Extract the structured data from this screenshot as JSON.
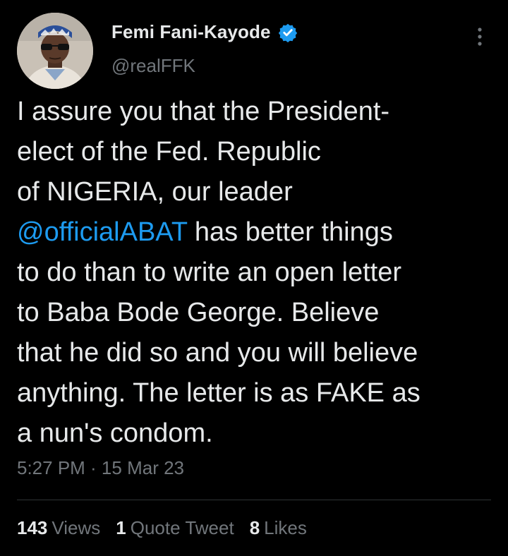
{
  "author": {
    "display_name": "Femi Fani-Kayode",
    "handle": "@realFFK",
    "verified": true,
    "verified_color": "#1d9bf0"
  },
  "tweet": {
    "lines": [
      [
        {
          "text": "I assure you that the President-"
        }
      ],
      [
        {
          "text": "elect of the Fed. Republic"
        }
      ],
      [
        {
          "text": "of NIGERIA, our leader"
        }
      ],
      [
        {
          "text": "@officialABAT",
          "mention": true
        },
        {
          "text": " has better things"
        }
      ],
      [
        {
          "text": "to do than to write an open letter"
        }
      ],
      [
        {
          "text": "to Baba Bode George. Believe"
        }
      ],
      [
        {
          "text": "that he did so and you will believe"
        }
      ],
      [
        {
          "text": "anything. The letter is as FAKE as"
        }
      ],
      [
        {
          "text": "a nun's condom."
        }
      ]
    ],
    "timestamp": "5:27 PM · 15 Mar 23"
  },
  "stats": {
    "views_count": "143",
    "views_label": "Views",
    "quotes_count": "1",
    "quotes_label": "Quote Tweet",
    "likes_count": "8",
    "likes_label": "Likes"
  },
  "colors": {
    "background": "#000000",
    "text": "#e7e9ea",
    "secondary": "#71767b",
    "link": "#1d9bf0",
    "divider": "#2f3336"
  },
  "icons": {
    "verified": "verified-badge-icon",
    "more": "more-options-icon"
  }
}
